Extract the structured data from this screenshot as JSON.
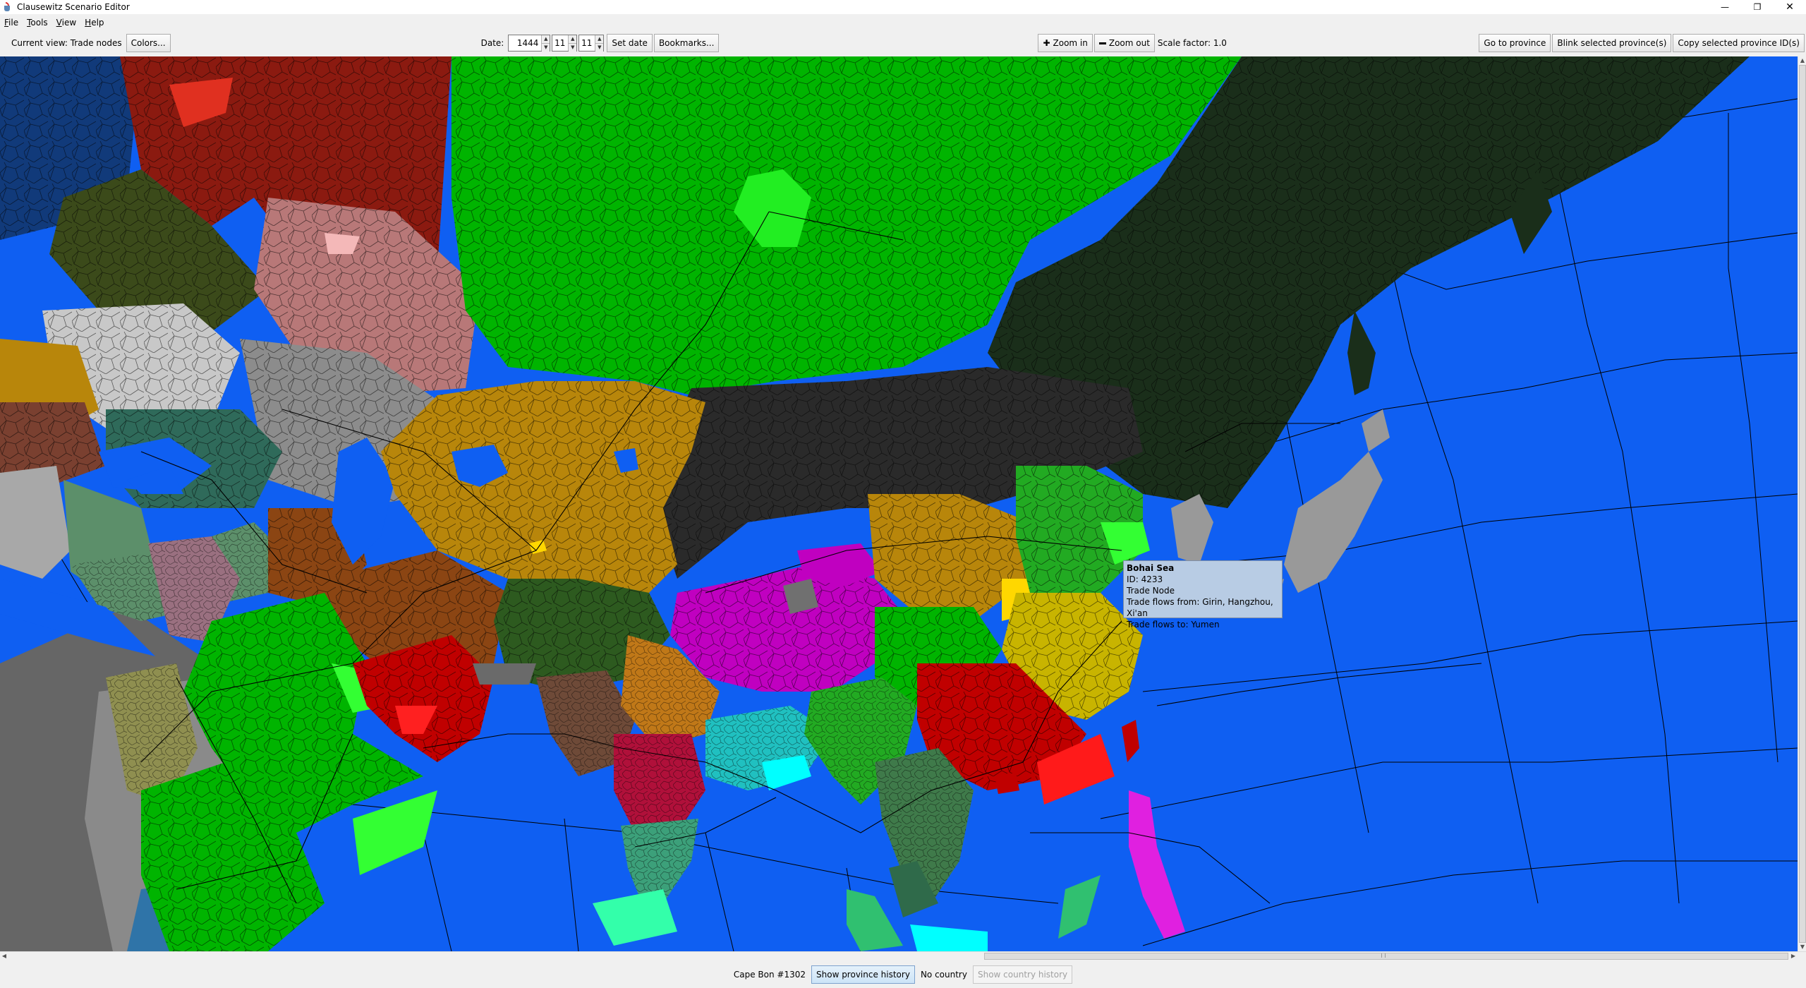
{
  "window": {
    "title": "Clausewitz Scenario Editor",
    "minimize": "—",
    "restore": "❐",
    "close": "✕"
  },
  "menu": {
    "items": [
      {
        "mn": "F",
        "rest": "ile"
      },
      {
        "mn": "T",
        "rest": "ools"
      },
      {
        "mn": "V",
        "rest": "iew"
      },
      {
        "mn": "H",
        "rest": "elp"
      }
    ]
  },
  "toolbar": {
    "current_view": "Current view: Trade nodes",
    "colors_button": "Colors...",
    "date_label": "Date:",
    "year": "1444",
    "month": "11",
    "day": "11",
    "set_date_button": "Set date",
    "bookmarks_button": "Bookmarks...",
    "zoom_in_button": "Zoom in",
    "zoom_out_button": "Zoom out",
    "scale_label": "Scale factor: 1.0",
    "goto_button": "Go to province",
    "blink_button": "Blink selected province(s)",
    "copy_button": "Copy selected province ID(s)"
  },
  "tooltip": {
    "title": "Bohai Sea",
    "id": "ID: 4233",
    "type": "Trade Node",
    "flows_from": "Trade flows from: Girin, Hangzhou, Xi'an",
    "flows_to": "Trade flows to: Yumen"
  },
  "status": {
    "province": "Cape Bon #1302",
    "show_province_history": "Show province history",
    "country": "No country",
    "show_country_history": "Show country history"
  },
  "colors": {
    "ocean": "#0f5ff2",
    "steppe_green": "#00b400",
    "manchuria_dark": "#1a2e1a",
    "mongolia_black": "#2a2a2a",
    "gold": "#b8860b",
    "china_red": "#c00000",
    "tibet_magenta": "#c000c0",
    "grey": "#9a9a9a"
  }
}
